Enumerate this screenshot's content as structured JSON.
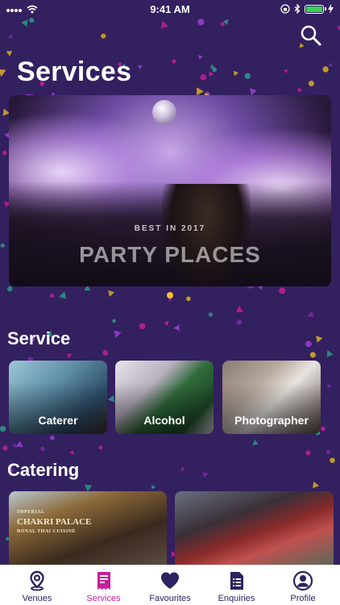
{
  "status_bar": {
    "time": "9:41 AM",
    "battery_level": 1.0
  },
  "header": {
    "title": "Services",
    "search_icon": "search-icon"
  },
  "banner": {
    "kicker": "BEST IN 2017",
    "headline": "PARTY PLACES",
    "page_indicator": {
      "count": 1,
      "active_index": 0,
      "color": "#f2c230"
    }
  },
  "service_section": {
    "title": "Service",
    "items": [
      {
        "label": "Caterer"
      },
      {
        "label": "Alcohol"
      },
      {
        "label": "Photographer"
      }
    ]
  },
  "catering_section": {
    "title": "Catering",
    "items": [
      {
        "sign_top": "IMPERIAL",
        "sign_name": "CHAKRI PALACE",
        "sign_sub": "ROYAL THAI CUISINE"
      },
      {
        "sign_top": "",
        "sign_name": "",
        "sign_sub": ""
      }
    ]
  },
  "tab_bar": {
    "active": "Services",
    "active_color": "#c61f9a",
    "inactive_color": "#2b2260",
    "tabs": [
      {
        "label": "Venues",
        "icon": "location-pin-icon"
      },
      {
        "label": "Services",
        "icon": "document-icon"
      },
      {
        "label": "Favourites",
        "icon": "heart-icon"
      },
      {
        "label": "Enquiries",
        "icon": "list-document-icon"
      },
      {
        "label": "Profile",
        "icon": "user-circle-icon"
      }
    ]
  },
  "theme": {
    "background": "#33205f",
    "confetti_colors": [
      "#c61f9a",
      "#9a3fd0",
      "#2a9a8a",
      "#d8b020",
      "#7a2aa8"
    ]
  }
}
